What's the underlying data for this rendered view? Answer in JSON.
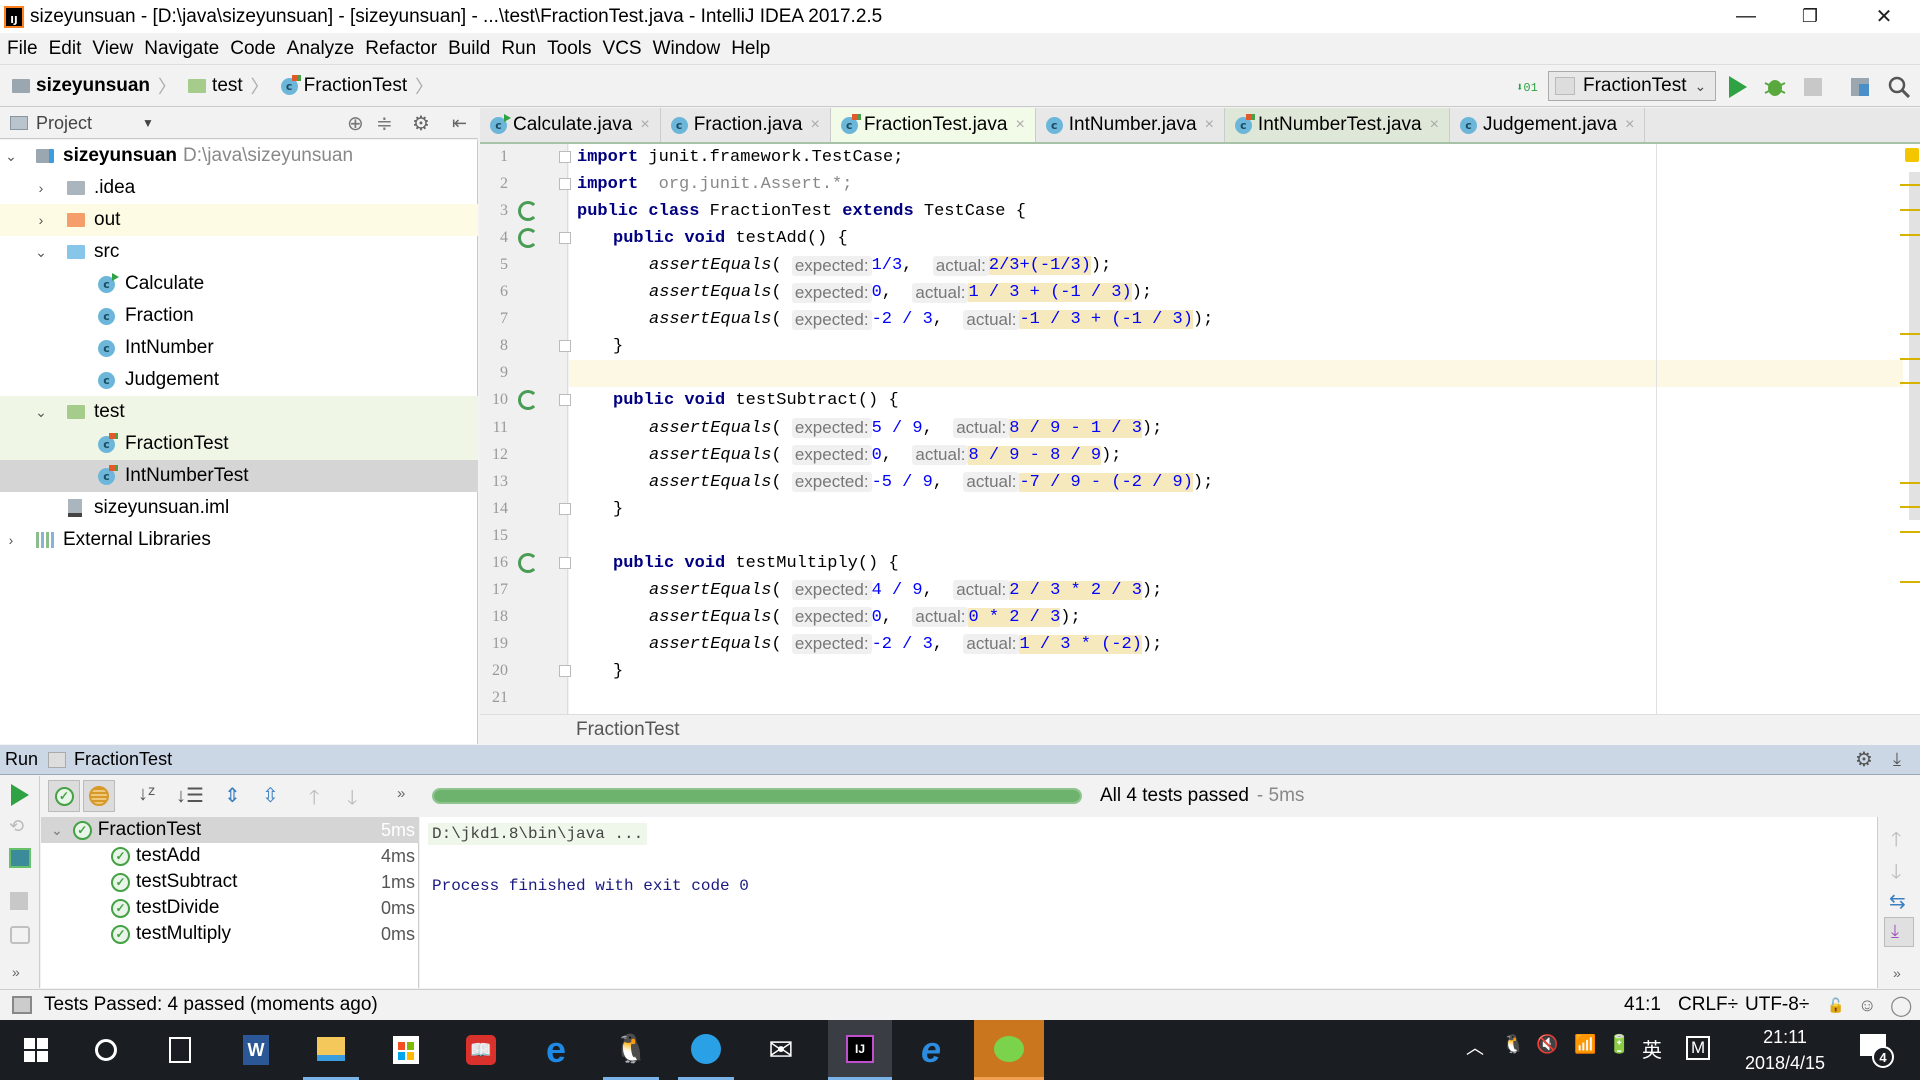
{
  "window": {
    "title": "sizeyunsuan - [D:\\java\\sizeyunsuan] - [sizeyunsuan] - ...\\test\\FractionTest.java - IntelliJ IDEA 2017.2.5",
    "minimize": "—",
    "maximize": "❐",
    "close": "✕"
  },
  "menu": [
    "File",
    "Edit",
    "View",
    "Navigate",
    "Code",
    "Analyze",
    "Refactor",
    "Build",
    "Run",
    "Tools",
    "VCS",
    "Window",
    "Help"
  ],
  "navbar": {
    "crumbs": [
      "sizeyunsuan",
      "test",
      "FractionTest"
    ],
    "run_config": "FractionTest"
  },
  "project_panel": {
    "title": "Project",
    "tree": [
      {
        "label": "sizeyunsuan",
        "path": "D:\\java\\sizeyunsuan",
        "type": "module",
        "expanded": true
      },
      {
        "label": ".idea",
        "type": "folder-gray",
        "expanded": false
      },
      {
        "label": "out",
        "type": "folder-orange",
        "expanded": false
      },
      {
        "label": "src",
        "type": "folder-blue",
        "expanded": true
      },
      {
        "label": "Calculate",
        "type": "class-run"
      },
      {
        "label": "Fraction",
        "type": "class"
      },
      {
        "label": "IntNumber",
        "type": "class"
      },
      {
        "label": "Judgement",
        "type": "class"
      },
      {
        "label": "test",
        "type": "folder-green",
        "expanded": true
      },
      {
        "label": "FractionTest",
        "type": "class-test"
      },
      {
        "label": "IntNumberTest",
        "type": "class-test"
      },
      {
        "label": "sizeyunsuan.iml",
        "type": "file"
      },
      {
        "label": "External Libraries",
        "type": "libraries",
        "expanded": false
      }
    ]
  },
  "tabs": [
    {
      "label": "Calculate.java",
      "icon": "class-run"
    },
    {
      "label": "Fraction.java",
      "icon": "class"
    },
    {
      "label": "FractionTest.java",
      "icon": "class-test",
      "active": true
    },
    {
      "label": "IntNumber.java",
      "icon": "class"
    },
    {
      "label": "IntNumberTest.java",
      "icon": "class-test"
    },
    {
      "label": "Judgement.java",
      "icon": "class"
    }
  ],
  "code": {
    "lines": [
      "1",
      "2",
      "3",
      "4",
      "5",
      "6",
      "7",
      "8",
      "9",
      "10",
      "11",
      "12",
      "13",
      "14",
      "15",
      "16",
      "17",
      "18",
      "19",
      "20",
      "21"
    ],
    "import1_kw": "import",
    "import1": " junit.framework.TestCase;",
    "import2_kw": "import",
    "import2": "  org.junit.Assert.*;",
    "class_decl": [
      "public",
      " ",
      "class",
      " FractionTest ",
      "extends",
      " TestCase {"
    ],
    "methods": [
      {
        "name": "testAdd() {",
        "asserts": [
          {
            "expected": "1/3",
            "actual": "2/3+(-1/3)"
          },
          {
            "expected": "0",
            "actual": "1 / 3 + (-1 / 3)"
          },
          {
            "expected": "-2 / 3",
            "actual": "-1 / 3 + (-1 / 3)"
          }
        ]
      },
      {
        "name": "testSubtract() {",
        "asserts": [
          {
            "expected": "5 / 9",
            "actual": "8 / 9 - 1 / 3"
          },
          {
            "expected": "0",
            "actual": "8 / 9 - 8 / 9"
          },
          {
            "expected": "-5 / 9",
            "actual": "-7 / 9 - (-2 / 9)"
          }
        ]
      },
      {
        "name": "testMultiply() {",
        "asserts": [
          {
            "expected": "4 / 9",
            "actual": "2 / 3 * 2 / 3"
          },
          {
            "expected": "0",
            "actual": "0 * 2 / 3"
          },
          {
            "expected": "-2 / 3",
            "actual": "1 / 3 * (-2)"
          }
        ]
      }
    ],
    "assert_fn": "assertEquals",
    "hint_expected": "expected:",
    "hint_actual": "actual:",
    "kw_public": "public",
    "kw_void": "void",
    "close_brace": "}"
  },
  "editor_breadcrumb": "FractionTest",
  "run_panel": {
    "label": "Run",
    "config": "FractionTest",
    "summary": "All 4 tests passed",
    "summary_time": "- 5ms",
    "progress_percent": 100,
    "tests": [
      {
        "name": "FractionTest",
        "time": "5ms",
        "root": true
      },
      {
        "name": "testAdd",
        "time": "4ms"
      },
      {
        "name": "testSubtract",
        "time": "1ms"
      },
      {
        "name": "testDivide",
        "time": "0ms"
      },
      {
        "name": "testMultiply",
        "time": "0ms"
      }
    ],
    "console": [
      "D:\\jkd1.8\\bin\\java ...",
      "",
      "Process finished with exit code 0"
    ]
  },
  "statusbar": {
    "message": "Tests Passed: 4 passed (moments ago)",
    "position": "41:1",
    "line_sep": "CRLF÷",
    "encoding": "UTF-8÷"
  },
  "taskbar": {
    "time": "21:11",
    "date": "2018/4/15",
    "ime": "英",
    "ime2": "M",
    "notifications": "4"
  }
}
